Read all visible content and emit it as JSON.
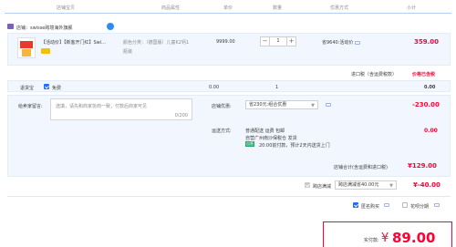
{
  "header": {
    "columns": [
      "店铺宝贝",
      "商品属性",
      "单价",
      "数量",
      "优惠方式",
      "小计"
    ]
  },
  "shop": {
    "name": "店铺：swisse跨境海外旗舰"
  },
  "item": {
    "title_line1": "【活动价】【新客开门红】Swi...",
    "title_line2": "",
    "attributes_line1": "颜色分类：（德国版）儿童K2钙1",
    "attributes_line2": "瓶装",
    "unit_price": "9999.00",
    "quantity": "1",
    "discount": "省9640:活动价",
    "subtotal": "359.00"
  },
  "tax": {
    "label": "进口税（含运费税款）",
    "value": "价格已含税"
  },
  "return_insurance": {
    "label": "退货宝",
    "option": "免费",
    "price": "0.00",
    "qty": "1",
    "subtotal": "0.00"
  },
  "buyer_note": {
    "label": "给卖家留言:",
    "placeholder": "选填，请先和商家协商一致，付款后商家可见",
    "counter": "0/200"
  },
  "shop_discount": {
    "label": "店铺优惠:",
    "value": "省230元:组合优惠",
    "amount": "-230.00"
  },
  "shipping": {
    "label": "运送方式:",
    "line1": "普通配送 运费 包邮",
    "line2": "自营广州南沙保税仓 发货",
    "tag": "自营",
    "line3": "20:00前付款，预计2天内送货上门",
    "amount": "0.00"
  },
  "shop_total": {
    "label": "店铺合计(含运费和进口税)",
    "value": "¥129.00"
  },
  "cross_store": {
    "label": "跨店满减",
    "value": "跨店满减省40.00元",
    "amount": "¥-40.00"
  },
  "options": {
    "anonymous": "匿名购买",
    "installment": "花呗分期"
  },
  "payment": {
    "label": "实付款:",
    "currency": "¥",
    "amount": "89.00"
  },
  "colors": {
    "accent_red": "#ff0036",
    "accent_blue": "#1f6cff",
    "panel_bg": "#f2f7ff"
  }
}
